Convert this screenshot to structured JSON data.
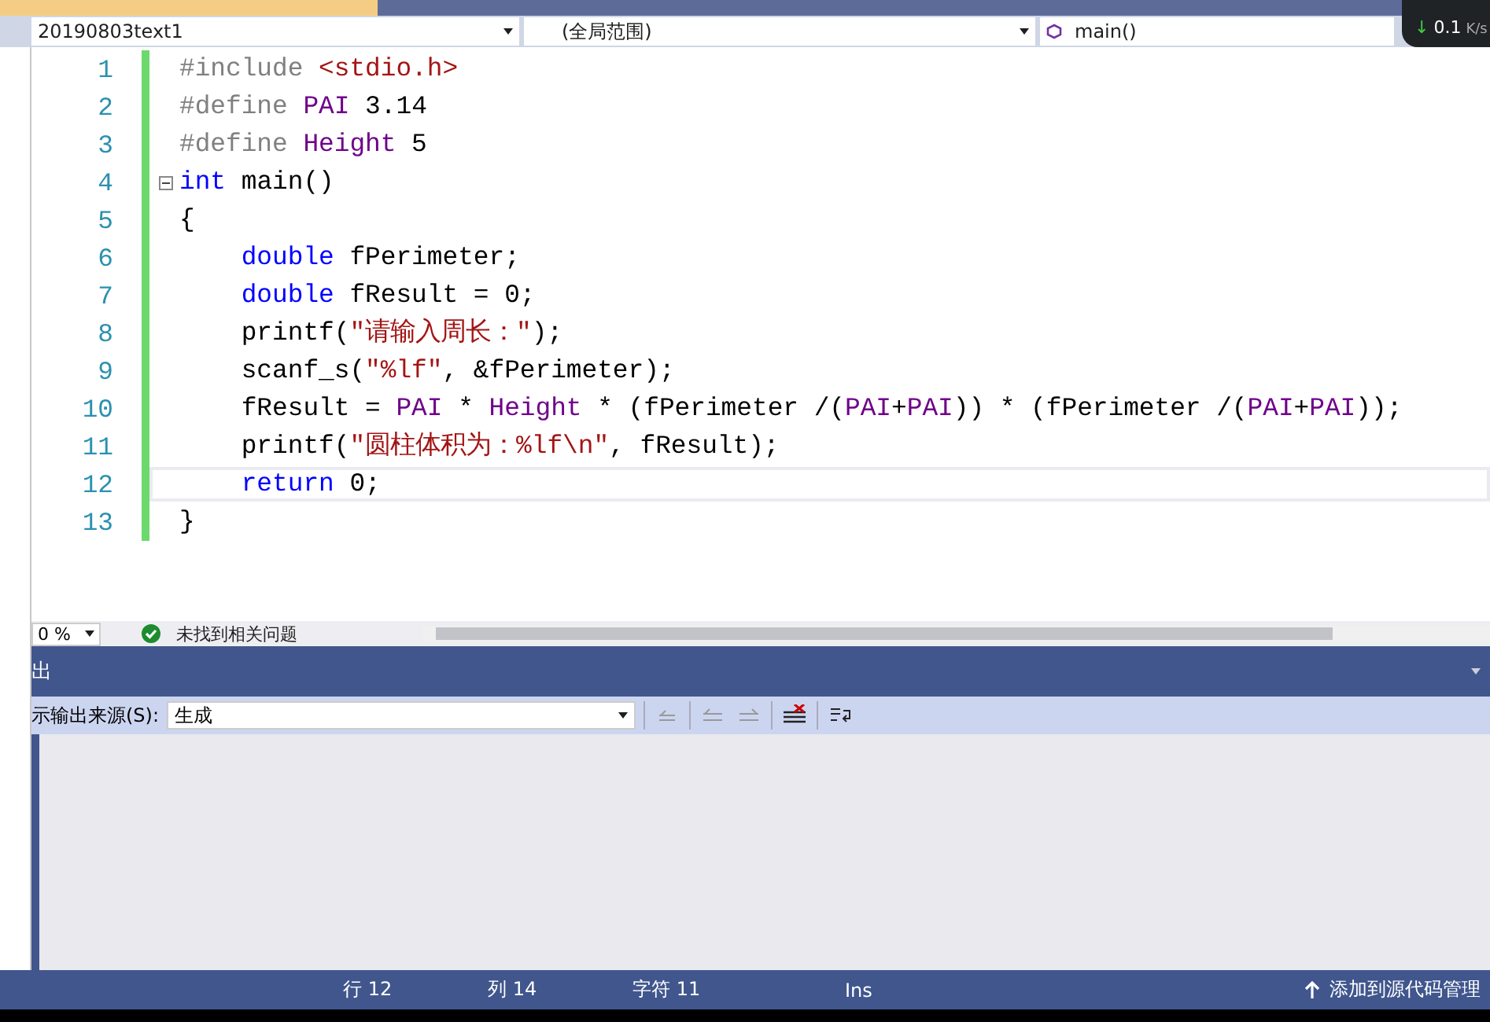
{
  "nav_bar": {
    "project": "20190803text1",
    "scope": "(全局范围)",
    "member": "main()"
  },
  "net_speed": {
    "arrow": "↓",
    "download": "0.1",
    "unit": "K/s"
  },
  "editor": {
    "lines": [
      {
        "number": "1",
        "current": false,
        "fold": false,
        "indent": false,
        "tokens": [
          {
            "kind": "pre",
            "text": "#include"
          },
          {
            "kind": "str",
            "text": " <stdio.h>"
          }
        ]
      },
      {
        "number": "2",
        "current": false,
        "fold": false,
        "indent": false,
        "tokens": [
          {
            "kind": "pre",
            "text": "#define"
          },
          {
            "kind": "macro",
            "text": " PAI"
          },
          {
            "kind": "plain",
            "text": " 3.14"
          }
        ]
      },
      {
        "number": "3",
        "current": false,
        "fold": false,
        "indent": false,
        "tokens": [
          {
            "kind": "pre",
            "text": "#define"
          },
          {
            "kind": "macro",
            "text": " Height"
          },
          {
            "kind": "plain",
            "text": " 5"
          }
        ]
      },
      {
        "number": "4",
        "current": false,
        "fold": true,
        "indent": false,
        "tokens": [
          {
            "kind": "kw",
            "text": "int"
          },
          {
            "kind": "plain",
            "text": " main()"
          }
        ]
      },
      {
        "number": "5",
        "current": false,
        "fold": false,
        "indent": false,
        "tokens": [
          {
            "kind": "plain",
            "text": "{"
          }
        ]
      },
      {
        "number": "6",
        "current": false,
        "fold": false,
        "indent": true,
        "tokens": [
          {
            "kind": "kw",
            "text": "double"
          },
          {
            "kind": "plain",
            "text": " fPerimeter;"
          }
        ]
      },
      {
        "number": "7",
        "current": false,
        "fold": false,
        "indent": true,
        "tokens": [
          {
            "kind": "kw",
            "text": "double"
          },
          {
            "kind": "plain",
            "text": " fResult = 0;"
          }
        ]
      },
      {
        "number": "8",
        "current": false,
        "fold": false,
        "indent": true,
        "tokens": [
          {
            "kind": "plain",
            "text": "printf("
          },
          {
            "kind": "str",
            "text": "\"请输入周长：\""
          },
          {
            "kind": "plain",
            "text": ");"
          }
        ]
      },
      {
        "number": "9",
        "current": false,
        "fold": false,
        "indent": true,
        "tokens": [
          {
            "kind": "plain",
            "text": "scanf_s("
          },
          {
            "kind": "str",
            "text": "\"%lf\""
          },
          {
            "kind": "plain",
            "text": ", &fPerimeter);"
          }
        ]
      },
      {
        "number": "10",
        "current": false,
        "fold": false,
        "indent": true,
        "tokens": [
          {
            "kind": "plain",
            "text": "fResult = "
          },
          {
            "kind": "macro",
            "text": "PAI"
          },
          {
            "kind": "plain",
            "text": " * "
          },
          {
            "kind": "macro",
            "text": "Height"
          },
          {
            "kind": "plain",
            "text": " * (fPerimeter /("
          },
          {
            "kind": "macro",
            "text": "PAI"
          },
          {
            "kind": "plain",
            "text": "+"
          },
          {
            "kind": "macro",
            "text": "PAI"
          },
          {
            "kind": "plain",
            "text": ")) * (fPerimeter /("
          },
          {
            "kind": "macro",
            "text": "PAI"
          },
          {
            "kind": "plain",
            "text": "+"
          },
          {
            "kind": "macro",
            "text": "PAI"
          },
          {
            "kind": "plain",
            "text": "));"
          }
        ]
      },
      {
        "number": "11",
        "current": false,
        "fold": false,
        "indent": true,
        "tokens": [
          {
            "kind": "plain",
            "text": "printf("
          },
          {
            "kind": "str",
            "text": "\"圆柱体积为：%lf\\n\""
          },
          {
            "kind": "plain",
            "text": ", fResult);"
          }
        ]
      },
      {
        "number": "12",
        "current": true,
        "fold": false,
        "indent": true,
        "tokens": [
          {
            "kind": "kw",
            "text": "return"
          },
          {
            "kind": "plain",
            "text": " 0;"
          }
        ]
      },
      {
        "number": "13",
        "current": false,
        "fold": false,
        "indent": false,
        "tokens": [
          {
            "kind": "plain",
            "text": "}"
          }
        ]
      }
    ]
  },
  "editor_status": {
    "zoom": "0 %",
    "issues": "未找到相关问题"
  },
  "output_panel": {
    "title": "出",
    "source_label": "示输出来源(S):",
    "source": "生成"
  },
  "status_bar": {
    "line": "行 12",
    "column": "列 14",
    "char": "字符 11",
    "mode": "Ins",
    "source_control": "添加到源代码管理"
  }
}
